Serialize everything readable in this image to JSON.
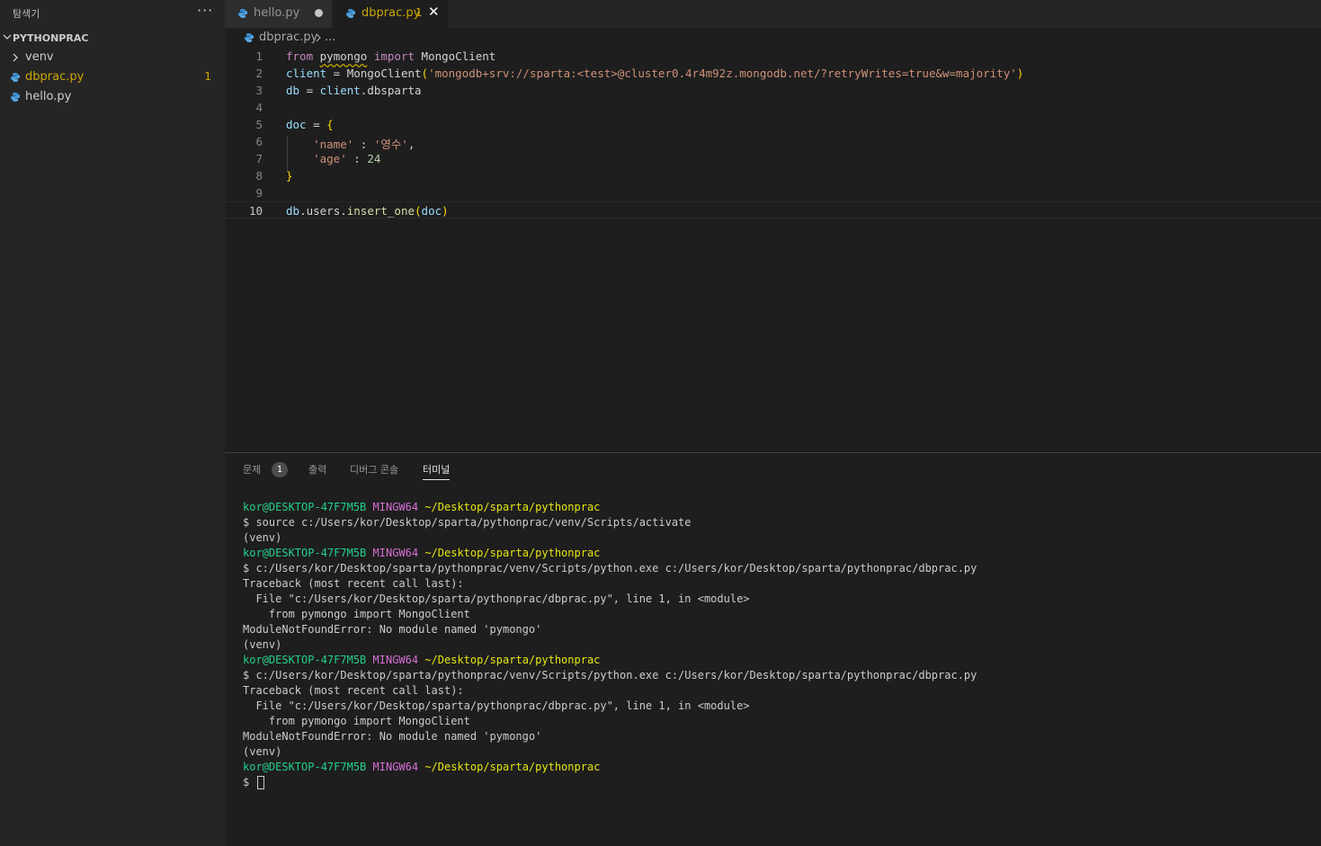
{
  "sidebar": {
    "title": "탐색기",
    "more": "···",
    "section": "PYTHONPRAC",
    "items": [
      {
        "name": "venv",
        "type": "folder"
      },
      {
        "name": "dbprac.py",
        "type": "file",
        "count": "1"
      },
      {
        "name": "hello.py",
        "type": "file"
      }
    ]
  },
  "tabs": [
    {
      "label": "hello.py",
      "active": false,
      "modified": true
    },
    {
      "label": "dbprac.py",
      "active": true,
      "count": "1",
      "close": "✕"
    }
  ],
  "breadcrumb": {
    "file": "dbprac.py",
    "rest": "..."
  },
  "editor": {
    "line_numbers": [
      "1",
      "2",
      "3",
      "4",
      "5",
      "6",
      "7",
      "8",
      "9",
      "10"
    ],
    "current_line": "10",
    "tokens": {
      "l1_from": "from",
      "l1_mod": "pymongo",
      "l1_import": "import",
      "l1_cls": "MongoClient",
      "l2_var": "client",
      "l2_eq": " = ",
      "l2_fn": "MongoClient",
      "l2_open": "(",
      "l2_str": "'mongodb+srv://sparta:<test>@cluster0.4r4m92z.mongodb.net/?retryWrites=true&w=majority'",
      "l2_close": ")",
      "l3_var": "db",
      "l3_eq": " = ",
      "l3_obj": "client",
      "l3_attr": ".dbsparta",
      "l5_var": "doc",
      "l5_eq": " = ",
      "l5_open": "{",
      "l6_key": "'name'",
      "l6_colon": " : ",
      "l6_val": "'영수'",
      "l6_comma": ",",
      "l7_key": "'age'",
      "l7_colon": " : ",
      "l7_val": "24",
      "l8_close": "}",
      "l10_obj": "db",
      "l10_attr": ".users.",
      "l10_fn": "insert_one",
      "l10_open": "(",
      "l10_arg": "doc",
      "l10_close": ")"
    }
  },
  "panel": {
    "tabs": [
      {
        "label": "문제",
        "badge": "1"
      },
      {
        "label": "출력"
      },
      {
        "label": "디버그 콘솔"
      },
      {
        "label": "터미널",
        "active": true
      }
    ],
    "terminal": {
      "user": "kor@DESKTOP-47F7M5B",
      "env": "MINGW64",
      "path": "~/Desktop/sparta/pythonprac",
      "cmd_activate": "$ source c:/Users/kor/Desktop/sparta/pythonprac/venv/Scripts/activate",
      "venv": "(venv)",
      "cmd_run": "$ c:/Users/kor/Desktop/sparta/pythonprac/venv/Scripts/python.exe c:/Users/kor/Desktop/sparta/pythonprac/dbprac.py",
      "tb_header": "Traceback (most recent call last):",
      "tb_file": "  File \"c:/Users/kor/Desktop/sparta/pythonprac/dbprac.py\", line 1, in <module>",
      "tb_code": "    from pymongo import MongoClient",
      "tb_error": "ModuleNotFoundError: No module named 'pymongo'",
      "prompt": "$"
    }
  }
}
